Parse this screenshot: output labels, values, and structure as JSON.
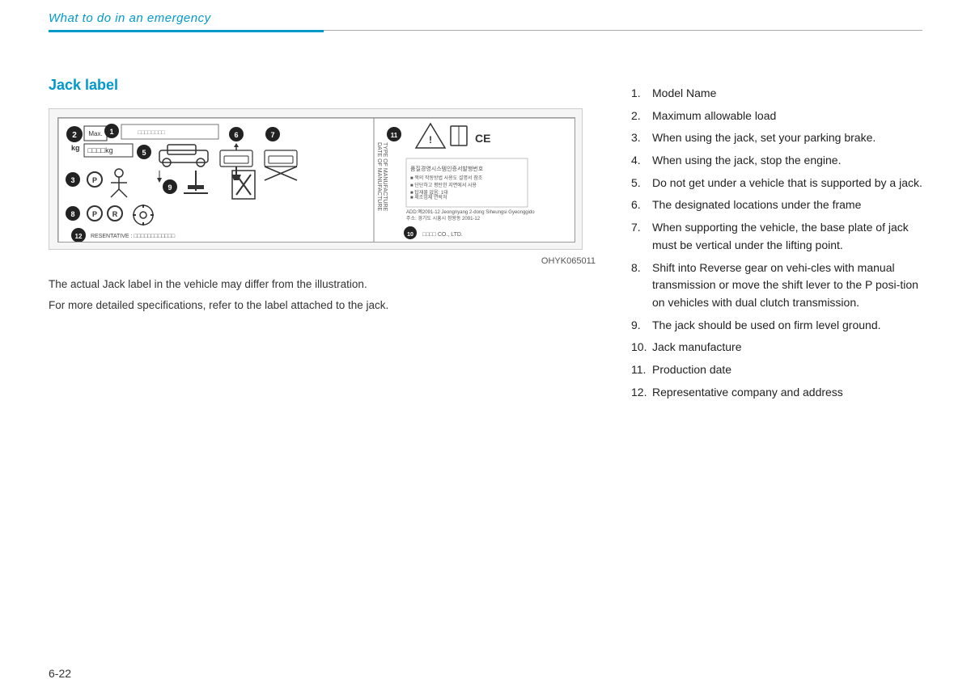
{
  "header": {
    "title": "What to do in an emergency"
  },
  "section": {
    "title": "Jack label"
  },
  "image": {
    "caption": "OHYK065011",
    "description_line1": "The actual Jack label in the vehicle may differ from the illustration.",
    "description_line2": "For more detailed specifications, refer to the label attached to the jack."
  },
  "list": {
    "items": [
      {
        "number": "1.",
        "text": "Model Name"
      },
      {
        "number": "2.",
        "text": "Maximum allowable load"
      },
      {
        "number": "3.",
        "text": "When  using  the  jack,  set  your parking brake."
      },
      {
        "number": "4.",
        "text": "When  using  the  jack,  stop  the engine."
      },
      {
        "number": "5.",
        "text": "Do not get under a vehicle that is supported by a jack."
      },
      {
        "number": "6.",
        "text": "The  designated  locations  under the frame"
      },
      {
        "number": "7.",
        "text": "When  supporting  the  vehicle,  the base plate of jack must be vertical under the lifting point."
      },
      {
        "number": "8.",
        "text": "Shift  into  Reverse  gear  on  vehi-cles  with  manual  transmission  or move the shift lever to the P posi-tion  on  vehicles  with  dual  clutch transmission."
      },
      {
        "number": "9.",
        "text": "The  jack  should  be  used  on  firm level ground."
      },
      {
        "number": "10.",
        "text": "Jack manufacture"
      },
      {
        "number": "11.",
        "text": "Production date"
      },
      {
        "number": "12.",
        "text": "Representative   company   and address"
      }
    ]
  },
  "footer": {
    "page_number": "6-22"
  }
}
